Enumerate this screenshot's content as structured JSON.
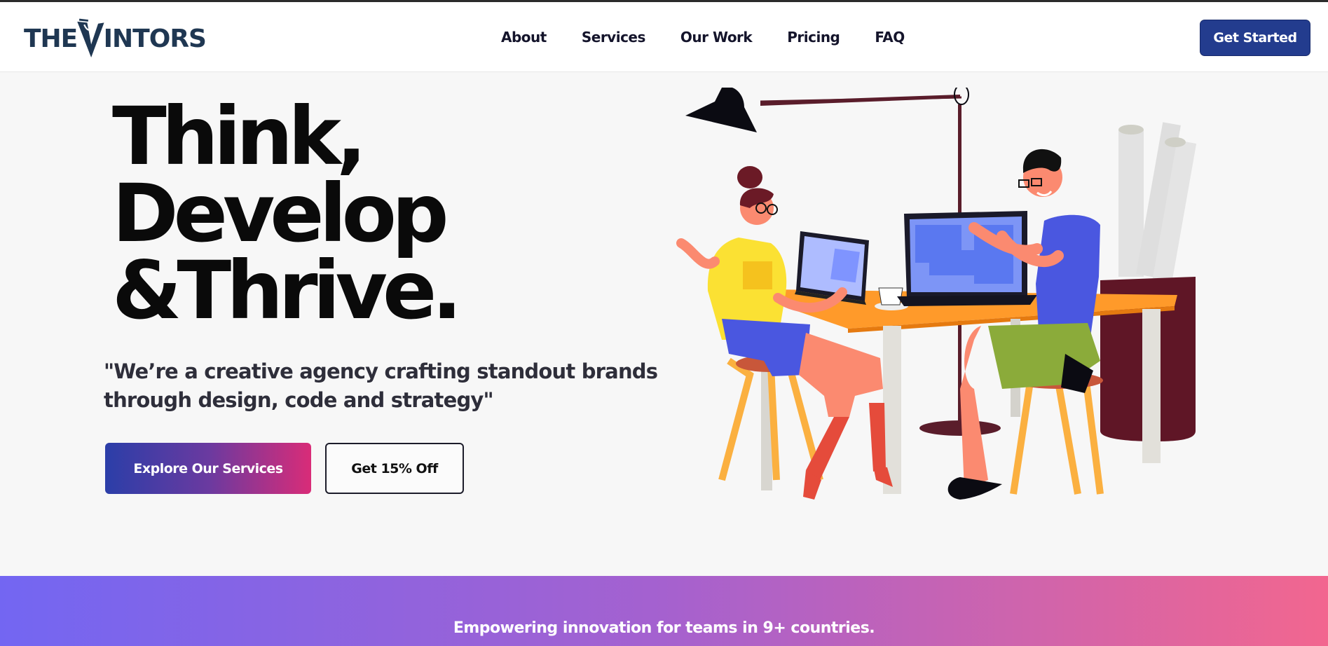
{
  "header": {
    "logo": {
      "prefix": "THE",
      "rest": "INTORS",
      "icon": "v-logo-icon"
    },
    "nav": [
      {
        "label": "About"
      },
      {
        "label": "Services"
      },
      {
        "label": "Our Work"
      },
      {
        "label": "Pricing"
      },
      {
        "label": "FAQ"
      }
    ],
    "cta_label": "Get Started"
  },
  "hero": {
    "title_lines": [
      "Think,",
      "Develop",
      "&Thrive."
    ],
    "tagline": "\"We’re a creative agency crafting standout brands through design, code and strategy\"",
    "primary_button": "Explore Our Services",
    "secondary_button": "Get 15% Off",
    "illustration": "two-people-working-at-desk-illustration"
  },
  "banner": {
    "text": "Empowering innovation for teams in 9+ countries."
  },
  "colors": {
    "brand_navy": "#1f3752",
    "cta_blue": "#233c8e",
    "gradient_start": "#2b3ea8",
    "gradient_end": "#d92c78",
    "banner_start": "#7366f2",
    "banner_end": "#f2668f"
  }
}
